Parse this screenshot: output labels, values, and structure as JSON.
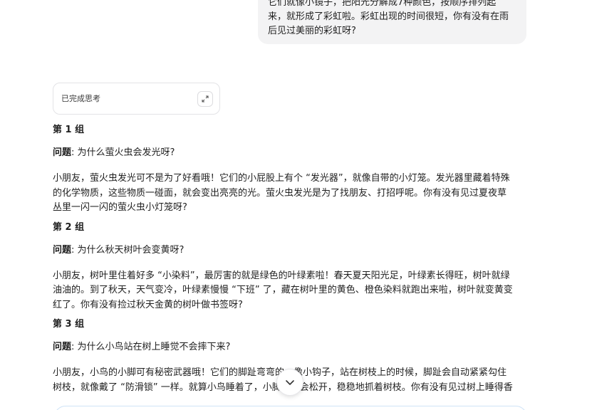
{
  "user_message": {
    "lines": [
      "它们就像小镜子，把阳光分解成7种颜色，按顺序排列起",
      "来，就形成了彩虹啦。彩虹出现的时间很短，你有没有在雨",
      "后见过美丽的彩虹呀?"
    ]
  },
  "thinking": {
    "label": "已完成思考",
    "expand_icon": "expand-icon"
  },
  "groups": [
    {
      "title": "第 1 组",
      "question_label": "问题",
      "question_text": ": 为什么萤火虫会发光呀?",
      "answer_lines": [
        "小朋友，萤火虫发光可不是为了好看哦！它们的小屁股上有个 “发光器”，就像自带的小灯笼。发光器里藏着特殊",
        "的化学物质，这些物质一碰面，就会变出亮亮的光。萤火虫发光是为了找朋友、打招呼呢。你有没有见过夏夜草",
        "丛里一闪一闪的萤火虫小灯笼呀?"
      ]
    },
    {
      "title": "第 2 组",
      "question_label": "问题",
      "question_text": ": 为什么秋天树叶会变黄呀?",
      "answer_lines": [
        "小朋友，树叶里住着好多 “小染料”，最厉害的就是绿色的叶绿素啦！春天夏天阳光足，叶绿素长得旺，树叶就绿",
        "油油的。到了秋天，天气变冷，叶绿素慢慢 “下班” 了，藏在树叶里的黄色、橙色染料就跑出来啦，树叶就变黄变",
        "红了。你有没有捡过秋天金黄的树叶做书签呀?"
      ]
    },
    {
      "title": "第 3 组",
      "question_label": "问题",
      "question_text": ": 为什么小鸟站在树上睡觉不会摔下来?",
      "answer_lines": [
        "小朋友，小鸟的小脚可有秘密武器哦！它们的脚趾弯弯的，像小钩子，站在树枝上的时候，脚趾会自动紧紧勾住",
        "树枝，就像戴了 “防滑锁” 一样。就算小鸟睡着了，小脚也不会松开，稳稳地抓着树枝。你有没有见过树上睡得香"
      ]
    }
  ],
  "scroll_button": {
    "icon": "chevron-down-icon"
  },
  "colors": {
    "bubble_bg": "#f3f3f4",
    "border": "#e3e3e6",
    "text": "#1f1f1f"
  }
}
